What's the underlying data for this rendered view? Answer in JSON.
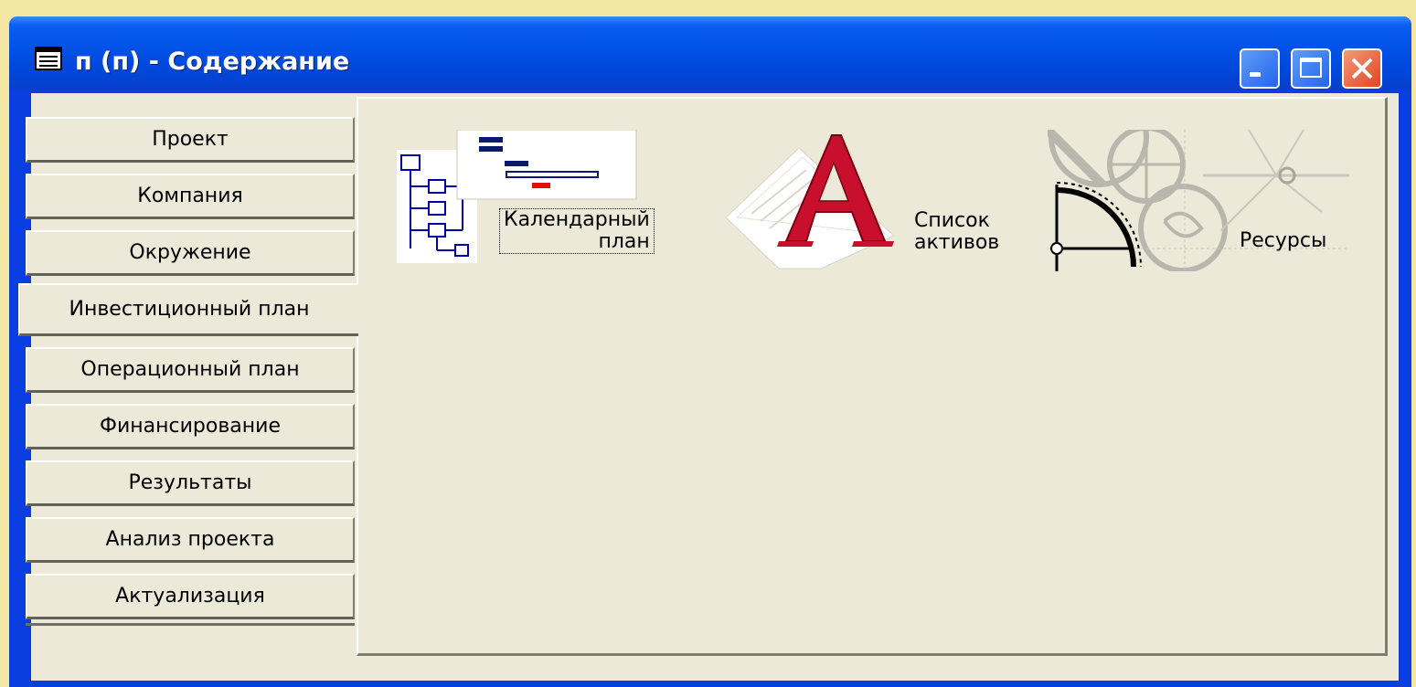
{
  "window": {
    "title": "п (п) - Содержание",
    "icon": "window-document-icon"
  },
  "titlebar_buttons": {
    "minimize_icon": "minimize-icon",
    "maximize_icon": "maximize-icon",
    "close_icon": "close-icon"
  },
  "tabs": [
    {
      "label": "Проект"
    },
    {
      "label": "Компания"
    },
    {
      "label": "Окружение"
    },
    {
      "label": "Инвестиционный план",
      "selected": true
    },
    {
      "label": "Операционный план"
    },
    {
      "label": "Финансирование"
    },
    {
      "label": "Результаты"
    },
    {
      "label": "Анализ проекта"
    },
    {
      "label": "Актуализация"
    }
  ],
  "modules": [
    {
      "label_line1": "Календарный",
      "label_line2": "план",
      "icon": "gantt-chart-icon",
      "focused": true
    },
    {
      "label_line1": "Список",
      "label_line2": "активов",
      "icon": "letter-a-document-icon"
    },
    {
      "label_line1": "Ресурсы",
      "icon": "gears-drafting-icon"
    }
  ],
  "colors": {
    "title_bar": "#0351e6",
    "client_bg": "#ece9d8",
    "desktop_bg": "#f4e6a3",
    "close_button": "#e14420",
    "icon_red": "#c8102e",
    "icon_blue": "#0000a8"
  }
}
